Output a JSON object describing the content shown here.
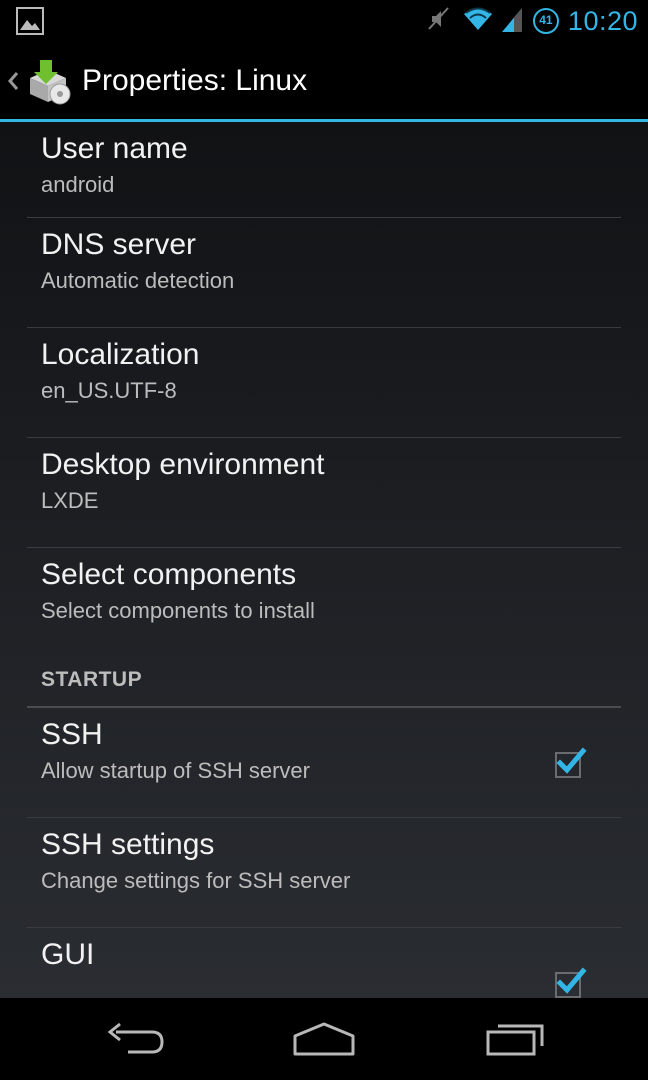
{
  "status_bar": {
    "time": "10:20",
    "battery_level": "41",
    "icons": [
      "image-notification-icon",
      "mute-icon",
      "wifi-icon",
      "cell-signal-icon",
      "battery-icon"
    ]
  },
  "action_bar": {
    "title": "Properties: Linux",
    "icons": [
      "up-caret-icon",
      "app-logo-icon"
    ]
  },
  "preferences": [
    {
      "title": "User name",
      "summary": "android"
    },
    {
      "title": "DNS server",
      "summary": "Automatic detection"
    },
    {
      "title": "Localization",
      "summary": "en_US.UTF-8"
    },
    {
      "title": "Desktop environment",
      "summary": "LXDE"
    },
    {
      "title": "Select components",
      "summary": "Select components to install"
    }
  ],
  "startup": {
    "category": "STARTUP",
    "items": [
      {
        "title": "SSH",
        "summary": "Allow startup of SSH server",
        "checked": true
      },
      {
        "title": "SSH settings",
        "summary": "Change settings for SSH server"
      },
      {
        "title": "GUI",
        "summary": "",
        "checked": true
      }
    ]
  },
  "nav_bar": {
    "icons": [
      "back-icon",
      "home-icon",
      "recent-apps-icon"
    ]
  },
  "colors": {
    "accent": "#33b5e5",
    "background": "#000000",
    "divider": "#3a3c40"
  }
}
